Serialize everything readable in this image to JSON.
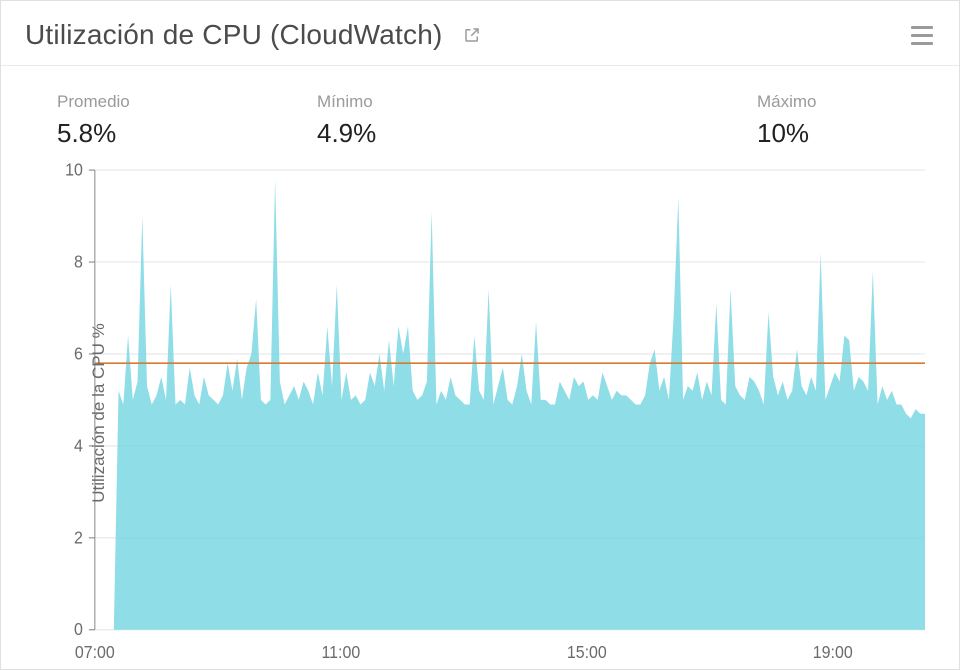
{
  "header": {
    "title": "Utilización de CPU (CloudWatch)"
  },
  "stats": {
    "avg_label": "Promedio",
    "avg_value": "5.8%",
    "min_label": "Mínimo",
    "min_value": "4.9%",
    "max_label": "Máximo",
    "max_value": "10%"
  },
  "axes": {
    "y_title": "Utilización de la CPU %",
    "y_ticks": [
      "0",
      "2",
      "4",
      "6",
      "8",
      "10"
    ],
    "x_ticks": [
      "07:00",
      "11:00",
      "15:00",
      "19:00"
    ]
  },
  "colors": {
    "area": "#7ad7e3",
    "avg_line": "#d97a2e",
    "grid": "#e6e6e6",
    "axis": "#888888",
    "tick_text": "#6b6b6b"
  },
  "chart_data": {
    "type": "area",
    "title": "Utilización de CPU (CloudWatch)",
    "xlabel": "",
    "ylabel": "Utilización de la CPU %",
    "ylim": [
      0,
      10
    ],
    "x_range": [
      "07:00",
      "20:30"
    ],
    "x_ticks": [
      "07:00",
      "11:00",
      "15:00",
      "19:00"
    ],
    "avg": 5.8,
    "min": 4.9,
    "max": 10,
    "values": [
      0,
      0,
      0,
      0,
      0,
      5.2,
      4.9,
      6.4,
      5.0,
      5.4,
      9.0,
      5.3,
      4.9,
      5.1,
      5.5,
      5.0,
      7.5,
      4.9,
      5.0,
      4.9,
      5.7,
      5.1,
      4.9,
      5.5,
      5.1,
      5.0,
      4.9,
      5.1,
      5.8,
      5.2,
      5.9,
      5.0,
      5.7,
      6.0,
      7.2,
      5.0,
      4.9,
      5.0,
      9.8,
      5.4,
      4.9,
      5.1,
      5.3,
      5.0,
      5.4,
      5.2,
      4.9,
      5.6,
      5.1,
      6.6,
      5.3,
      7.5,
      5.0,
      5.6,
      5.0,
      5.1,
      4.9,
      5.0,
      5.6,
      5.3,
      6.0,
      5.2,
      6.3,
      5.3,
      6.6,
      6.0,
      6.6,
      5.2,
      5.0,
      5.1,
      5.4,
      9.1,
      4.9,
      5.2,
      5.0,
      5.5,
      5.1,
      5.0,
      4.9,
      4.9,
      6.4,
      5.2,
      5.0,
      7.4,
      4.9,
      5.3,
      5.7,
      5.0,
      4.9,
      5.3,
      6.0,
      5.2,
      4.9,
      6.7,
      5.0,
      5.0,
      4.9,
      4.9,
      5.4,
      5.2,
      5.0,
      5.5,
      5.3,
      5.4,
      5.0,
      5.1,
      5.0,
      5.6,
      5.3,
      5.0,
      5.2,
      5.1,
      5.1,
      5.0,
      4.9,
      4.9,
      5.1,
      5.8,
      6.1,
      5.2,
      5.5,
      5.0,
      6.8,
      9.4,
      5.0,
      5.3,
      5.2,
      5.6,
      5.0,
      5.4,
      5.1,
      7.1,
      5.0,
      4.9,
      7.4,
      5.3,
      5.1,
      5.0,
      5.5,
      5.4,
      5.2,
      4.9,
      6.9,
      5.5,
      5.1,
      5.4,
      5.0,
      5.2,
      6.1,
      5.3,
      5.1,
      5.5,
      5.2,
      8.2,
      5.0,
      5.3,
      5.6,
      5.4,
      6.4,
      6.3,
      5.2,
      5.5,
      5.4,
      5.2,
      7.8,
      4.9,
      5.3,
      5.0,
      5.2,
      4.9,
      4.9,
      4.7,
      4.6,
      4.8,
      4.7,
      4.7
    ]
  }
}
